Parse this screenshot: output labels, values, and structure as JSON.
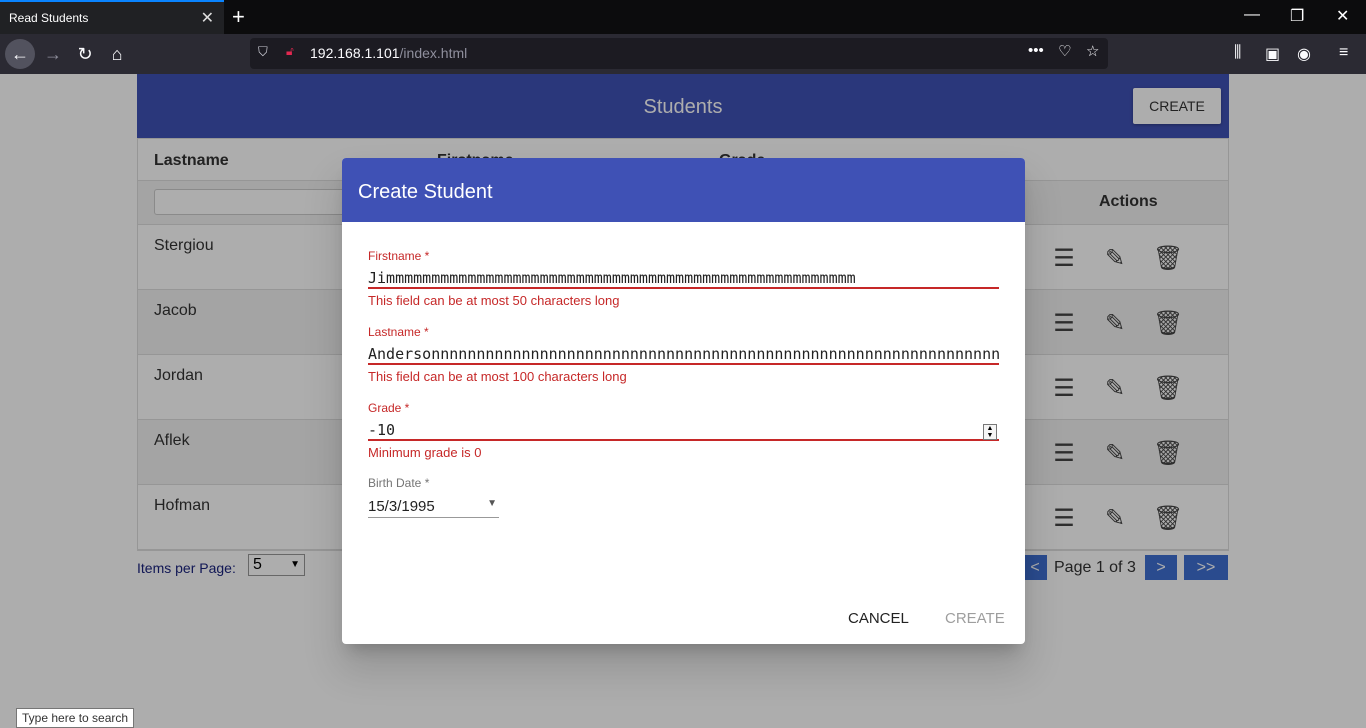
{
  "browser": {
    "tab_title": "Read Students",
    "url_host": "192.168.1.101",
    "url_path": "/index.html",
    "icons": [
      "back-icon",
      "forward-icon",
      "reload-icon",
      "home-icon",
      "shield-icon",
      "lock-icon",
      "more-icon",
      "pocket-icon",
      "star-icon",
      "library-icon",
      "sidebar-icon",
      "account-icon",
      "menu-icon"
    ]
  },
  "app": {
    "title": "Students",
    "create_button": "CREATE",
    "columns": [
      "Lastname",
      "Firstname",
      "Grade"
    ],
    "actions_header": "Actions",
    "rows": [
      {
        "lastname": "Stergiou"
      },
      {
        "lastname": "Jacob"
      },
      {
        "lastname": "Jordan"
      },
      {
        "lastname": "Aflek"
      },
      {
        "lastname": "Hofman"
      }
    ],
    "items_per_page_label": "Items per Page:",
    "items_per_page_value": "5",
    "page_text": "Page 1 of 3",
    "prev_label": "<",
    "next_label": ">",
    "last_label": ">>"
  },
  "dialog": {
    "title": "Create Student",
    "firstname": {
      "label": "Firstname *",
      "value": "Jimmmmmmmmmmmmmmmmmmmmmmmmmmmmmmmmmmmmmmmmmmmmmmmmmmmm",
      "error": "This field can be at most 50 characters long"
    },
    "lastname": {
      "label": "Lastname *",
      "value": "Andersonnnnnnnnnnnnnnnnnnnnnnnnnnnnnnnnnnnnnnnnnnnnnnnnnnnnnnnnnnnnnnnnnnn",
      "error": "This field can be at most 100 characters long"
    },
    "grade": {
      "label": "Grade *",
      "value": "-10",
      "error": "Minimum grade is 0"
    },
    "birthdate": {
      "label": "Birth Date *",
      "value": "15/3/1995"
    },
    "cancel_label": "CANCEL",
    "create_label": "CREATE"
  },
  "taskbar": {
    "search_tooltip": "Type here to search"
  }
}
